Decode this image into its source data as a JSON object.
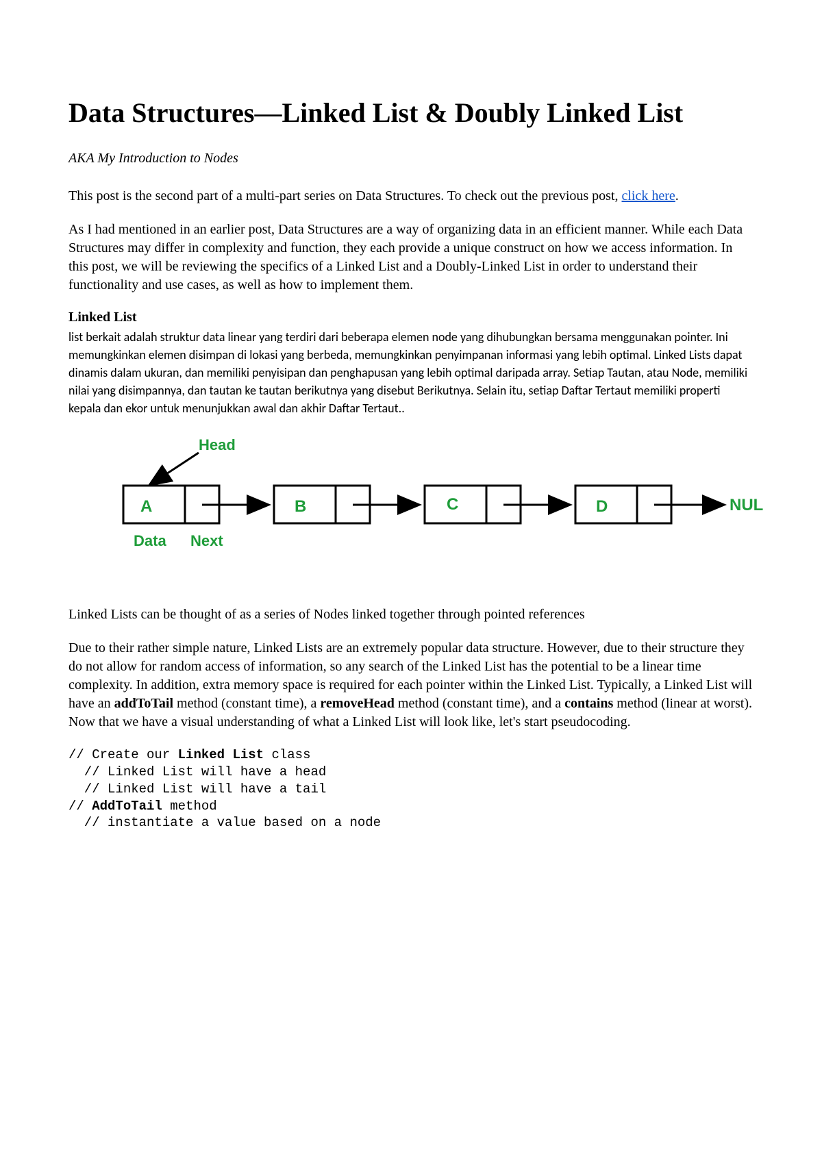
{
  "title": "Data Structures—Linked List & Doubly Linked List",
  "subtitle": "AKA My Introduction to Nodes",
  "p1_a": "This post is the second part of a multi-part series on Data Structures. To check out the previous post, ",
  "p1_link": "click here",
  "p1_b": ".",
  "p2": "As I had mentioned in an earlier post, Data Structures are a way of organizing data in an efficient manner. While each Data Structures may differ in complexity and function, they each provide a unique construct on how we access information. In this post, we will be reviewing the specifics of a Linked List and a Doubly-Linked List in order to understand their functionality and use cases, as well as how to implement them.",
  "h2": "Linked List",
  "indo": "list berkait adalah struktur data linear yang terdiri dari beberapa elemen node yang dihubungkan bersama menggunakan pointer. Ini memungkinkan elemen disimpan di lokasi yang berbeda, memungkinkan penyimpanan informasi yang lebih optimal. Linked Lists dapat dinamis dalam ukuran, dan memiliki penyisipan dan penghapusan yang lebih optimal daripada array. Setiap Tautan, atau Node, memiliki nilai yang disimpannya, dan tautan ke tautan berikutnya yang disebut Berikutnya. Selain itu, setiap Daftar Tertaut memiliki properti kepala dan ekor untuk menunjukkan awal dan akhir Daftar Tertaut..",
  "diagram": {
    "head": "Head",
    "nodeA": "A",
    "nodeB": "B",
    "nodeC": "C",
    "nodeD": "D",
    "null": "NUL",
    "data": "Data",
    "next": "Next"
  },
  "caption": "Linked Lists can be thought of as a series of Nodes linked together through pointed references",
  "p3_a": "Due to their rather simple nature, Linked Lists are an extremely popular data structure. However, due to their structure they do not allow for random access of information, so any search of the Linked List has the potential to be a linear time complexity. In addition, extra memory space is required for each pointer within the Linked List. Typically, a Linked List will have an ",
  "p3_b1": "addToTail",
  "p3_b": " method (constant time), a ",
  "p3_b2": "removeHead",
  "p3_c": " method (constant time), and a ",
  "p3_b3": "contains",
  "p3_d": " method (linear at worst). Now that we have a visual understanding of what a Linked List will look like, let's start pseudocoding.",
  "code": {
    "l1a": "// Create our ",
    "l1b": "Linked List",
    "l1c": " class",
    "l2": "  // Linked List will have a head",
    "l3": "  // Linked List will have a tail",
    "l4a": "// ",
    "l4b": "AddToTail",
    "l4c": " method",
    "l5": "  // instantiate a value based on a node"
  }
}
